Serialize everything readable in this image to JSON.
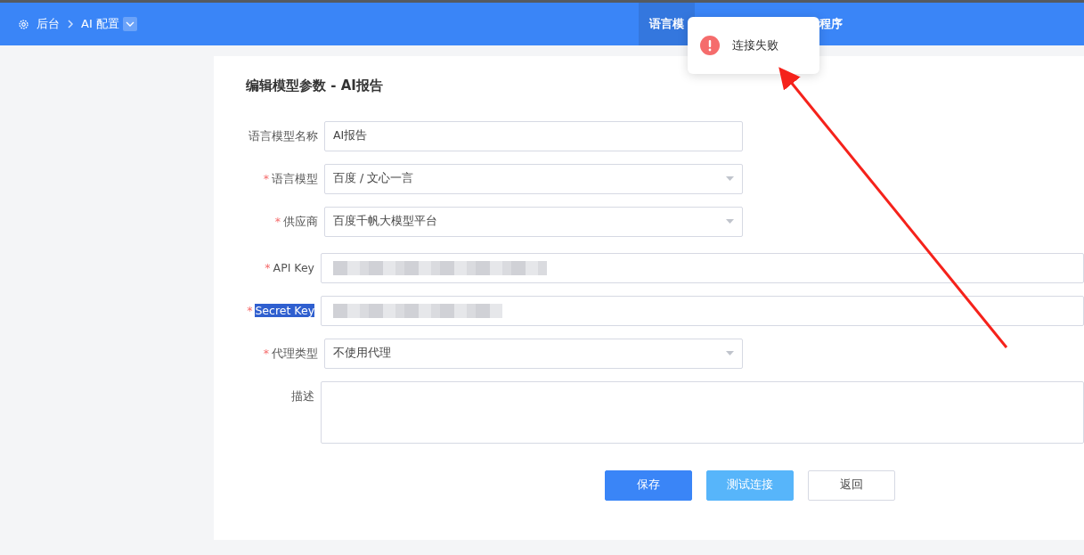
{
  "breadcrumb": [
    {
      "label": "后台",
      "kind": "home"
    },
    {
      "label": "AI 配置",
      "kind": "dropdown"
    }
  ],
  "tabs": [
    {
      "label": "语言模",
      "selected": true
    },
    {
      "label": "程序",
      "selected": false
    }
  ],
  "toast": {
    "kind": "error",
    "message": "连接失败"
  },
  "form": {
    "title": "编辑模型参数 - AI报告",
    "fields": [
      {
        "label": "语言模型名称",
        "kind": "text",
        "highlighted": false,
        "value": "AI报告"
      },
      {
        "required_mark": "*",
        "label": "语言模型",
        "kind": "select",
        "highlighted": false,
        "value": "百度 / 文心一言"
      },
      {
        "required_mark": "*",
        "label": "供应商",
        "kind": "select",
        "highlighted": false,
        "value": "百度千帆大模型平台"
      },
      {
        "required_mark": "*",
        "label": "API Key",
        "kind": "key",
        "highlighted": false,
        "redacted": true
      },
      {
        "required_mark": "*",
        "label": "Secret Key",
        "kind": "key",
        "highlighted": true,
        "redacted": true
      },
      {
        "required_mark": "*",
        "label": "代理类型",
        "kind": "select",
        "highlighted": false,
        "value": "不使用代理"
      },
      {
        "label": "描述",
        "kind": "textarea",
        "highlighted": false
      }
    ],
    "buttons": [
      {
        "label": "保存",
        "kind": "primary"
      },
      {
        "label": "测试连接",
        "kind": "test"
      },
      {
        "label": "返回",
        "kind": "plain"
      }
    ]
  }
}
